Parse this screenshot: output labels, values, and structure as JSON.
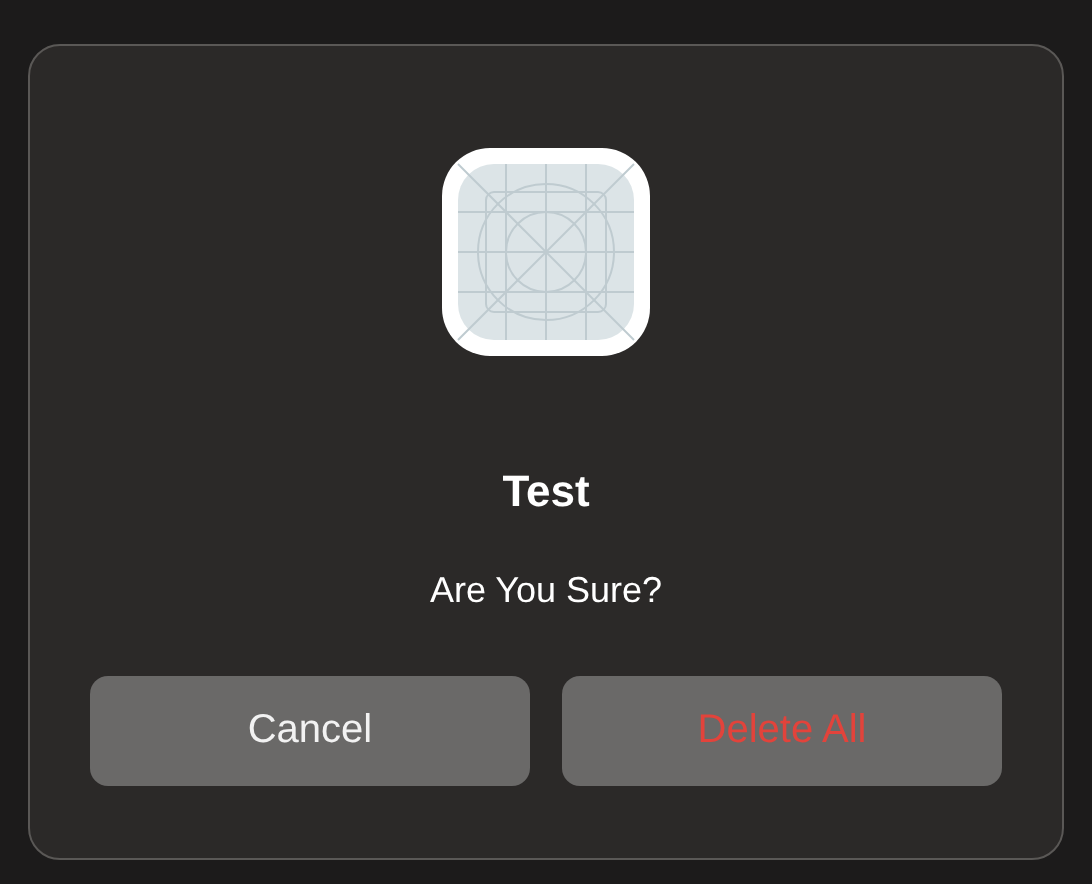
{
  "alert": {
    "title": "Test",
    "message": "Are You Sure?",
    "buttons": [
      {
        "label": "Cancel",
        "kind": "normal"
      },
      {
        "label": "Delete All",
        "kind": "destructive"
      }
    ]
  }
}
